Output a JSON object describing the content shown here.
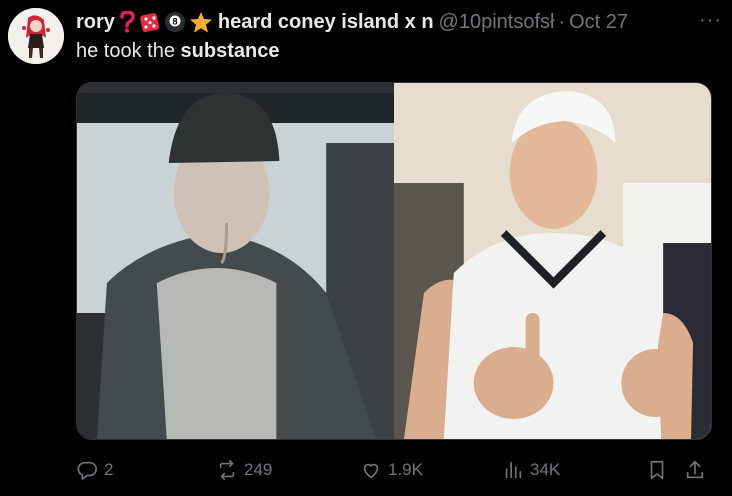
{
  "tweet": {
    "display_name": "rory",
    "name_emojis": [
      "question-mark-emoji",
      "dice-emoji",
      "eight-ball-emoji",
      "star-emoji"
    ],
    "name_suffix": "heard coney island x n",
    "handle": "@10pintsofsł",
    "separator": "·",
    "date": "Oct 27",
    "more": "···",
    "text_plain": "he took the ",
    "text_bold": "substance"
  },
  "media": {
    "left_image": "photo-man-beanie-grey-hoodie",
    "right_image": "photo-man-white-jersey-cap"
  },
  "actions": {
    "replies": "2",
    "reposts": "249",
    "likes": "1.9K",
    "views": "34K"
  },
  "colors": {
    "background": "#000000",
    "text": "#e7e9ea",
    "muted": "#71767b",
    "border": "#2f3336"
  }
}
